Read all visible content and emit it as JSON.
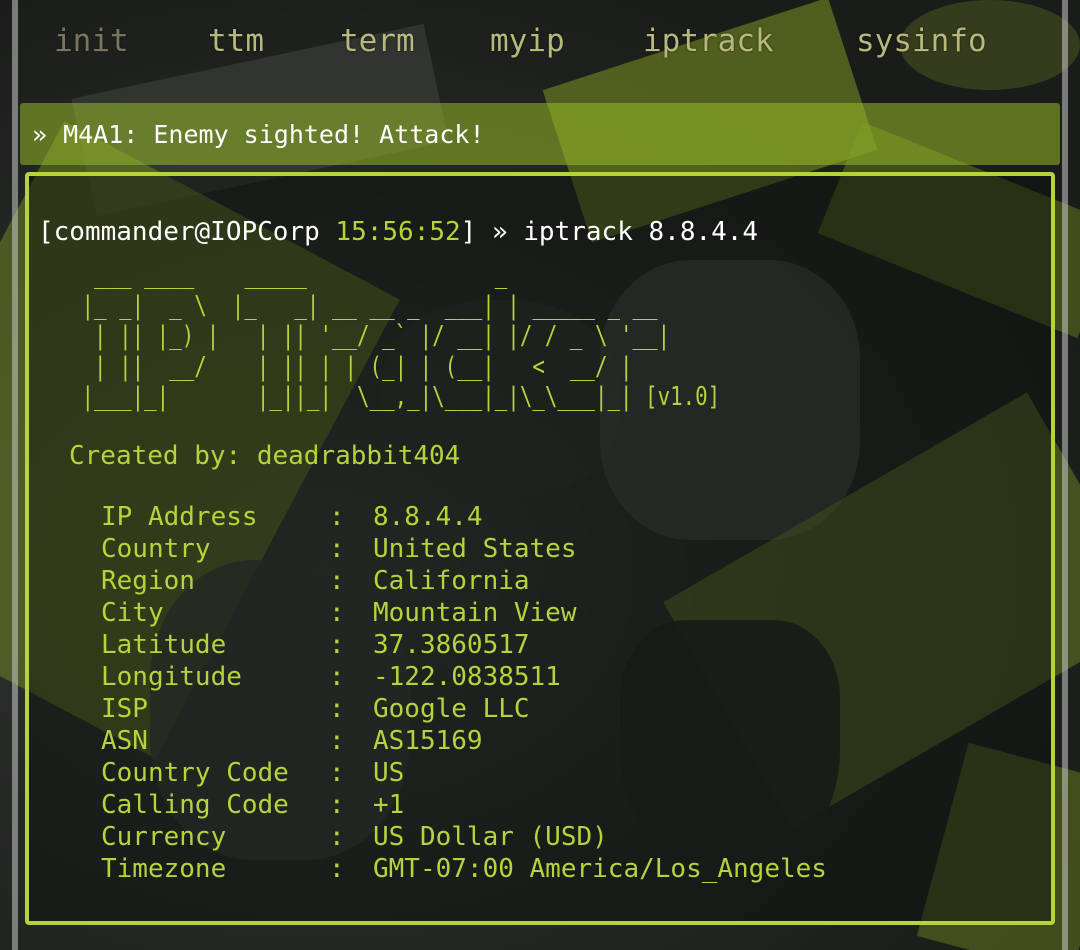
{
  "nav": {
    "items": [
      {
        "label": "init"
      },
      {
        "label": "ttm"
      },
      {
        "label": "term"
      },
      {
        "label": "myip"
      },
      {
        "label": "iptrack"
      },
      {
        "label": "sysinfo"
      }
    ]
  },
  "notification": {
    "arrow": "»",
    "text": "M4A1: Enemy sighted! Attack!"
  },
  "terminal": {
    "prompt_open": "[commander@IOPCorp ",
    "prompt_time": "15:56:52",
    "prompt_close": "] » ",
    "command": "iptrack 8.8.4.4",
    "ascii_banner": "  ___ ____    _____               _              \n |_ _|  _ \\  |_   _| __ __ _  ___| | _____ _ __ \n  | || |_) |   | || '__/ _` |/ __| |/ / _ \\ '__|\n  | ||  __/    | || | | (_| | (__|   <  __/ |   \n |___|_|       |_||_|  \\__,_|\\___|_|\\_\\___|_| [v1.0]",
    "created_by": "Created by: deadrabbit404",
    "separator": ":",
    "info": [
      {
        "key": "IP Address",
        "value": "8.8.4.4"
      },
      {
        "key": "Country",
        "value": "United States"
      },
      {
        "key": "Region",
        "value": "California"
      },
      {
        "key": "City",
        "value": "Mountain View"
      },
      {
        "key": "Latitude",
        "value": "37.3860517"
      },
      {
        "key": "Longitude",
        "value": "-122.0838511"
      },
      {
        "key": "ISP",
        "value": "Google LLC"
      },
      {
        "key": "ASN",
        "value": "AS15169"
      },
      {
        "key": "Country Code",
        "value": "US"
      },
      {
        "key": "Calling Code",
        "value": "+1"
      },
      {
        "key": "Currency",
        "value": "US Dollar (USD)"
      },
      {
        "key": "Timezone",
        "value": "GMT-07:00 America/Los_Angeles"
      }
    ]
  },
  "colors": {
    "accent": "#b5d33b",
    "notification_bg": "#96b928",
    "nav_text": "#b6b87c",
    "prompt_text": "#ffffff"
  }
}
